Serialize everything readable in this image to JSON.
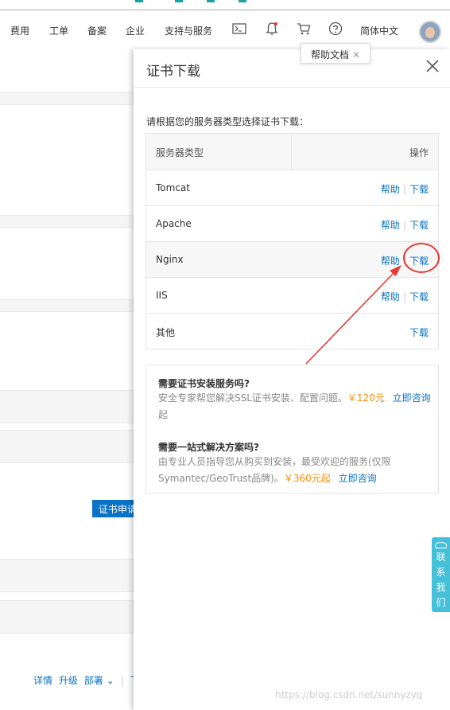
{
  "nav": {
    "items": [
      "费用",
      "工单",
      "备案",
      "企业",
      "支持与服务"
    ],
    "language": "简体中文"
  },
  "tooltip": {
    "label": "帮助文档"
  },
  "drawer": {
    "title": "证书下载",
    "instruction": "请根据您的服务器类型选择证书下载：",
    "table": {
      "col_server": "服务器类型",
      "col_action": "操作",
      "rows": [
        {
          "name": "Tomcat",
          "help": "帮助",
          "download": "下载"
        },
        {
          "name": "Apache",
          "help": "帮助",
          "download": "下载"
        },
        {
          "name": "Nginx",
          "help": "帮助",
          "download": "下载"
        },
        {
          "name": "IIS",
          "help": "帮助",
          "download": "下载"
        },
        {
          "name": "其他",
          "help": "",
          "download": "下载"
        }
      ]
    },
    "service": {
      "q1": "需要证书安装服务吗?",
      "t1_pre": "安全专家帮您解决SSL证书安装、配置问题。",
      "t1_price": "￥120元",
      "t1_link": "立即咨询",
      "t1_post": "起",
      "q2": "需要一站式解决方案吗?",
      "t2_pre": "由专业人员指导您从购买到安装，最受欢迎的服务(仅限Symantec/GeoTrust品牌)。",
      "t2_price": "￥360元起",
      "t2_link": "立即咨询"
    }
  },
  "left": {
    "apply_button": "证书申请",
    "links": [
      "详情",
      "升级",
      "部署",
      "下"
    ]
  },
  "contact": "联系我们",
  "watermark": "https://blog.csdn.net/sunnyzyq",
  "colors": {
    "link": "#0a73c5",
    "price": "#ff8a00",
    "annotation": "#e53935",
    "contact": "#45c0d8"
  }
}
